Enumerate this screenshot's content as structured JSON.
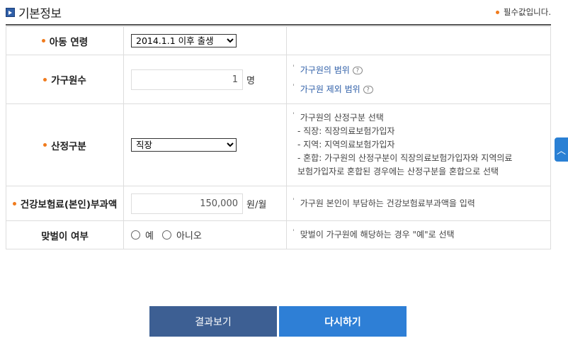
{
  "header": {
    "title": "기본정보",
    "required_note": "필수값입니다."
  },
  "colors": {
    "accent_orange": "#f07b1d",
    "button_result": "#3d5f93",
    "button_reset": "#2e7fd6",
    "link_blue": "#2f5fa8"
  },
  "rows": {
    "age": {
      "label": "아동 연령",
      "selected": "2014.1.1 이후 출생"
    },
    "household": {
      "label": "가구원수",
      "value": "1",
      "unit": "명",
      "links": [
        "가구원의 범위",
        "가구원 제외 범위"
      ],
      "help_icon": "?"
    },
    "calc_type": {
      "label": "산정구분",
      "selected": "직장",
      "desc": [
        "가구원의 산정구분 선택",
        "- 직장: 직장의료보험가입자",
        "- 지역: 지역의료보험가입자",
        "- 혼합: 가구원의 산정구분이 직장의료보험가입자와 지역의료",
        "보험가입자로 혼합된 경우에는 산정구분을 혼합으로 선택"
      ]
    },
    "premium": {
      "label": "건강보험료(본인)부과액",
      "value": "150,000",
      "unit": "원/월",
      "desc": "가구원 본인이 부담하는 건강보험료부과액을 입력"
    },
    "dual_income": {
      "label": "맞벌이 여부",
      "options": [
        "예",
        "아니오"
      ],
      "desc": "맞벌이 가구원에 해당하는 경우 \"예\"로 선택"
    }
  },
  "buttons": {
    "result": "결과보기",
    "reset": "다시하기"
  },
  "icons": {
    "title_icon": "square-arrow-icon",
    "scroll_top": "chevron-up-icon"
  }
}
